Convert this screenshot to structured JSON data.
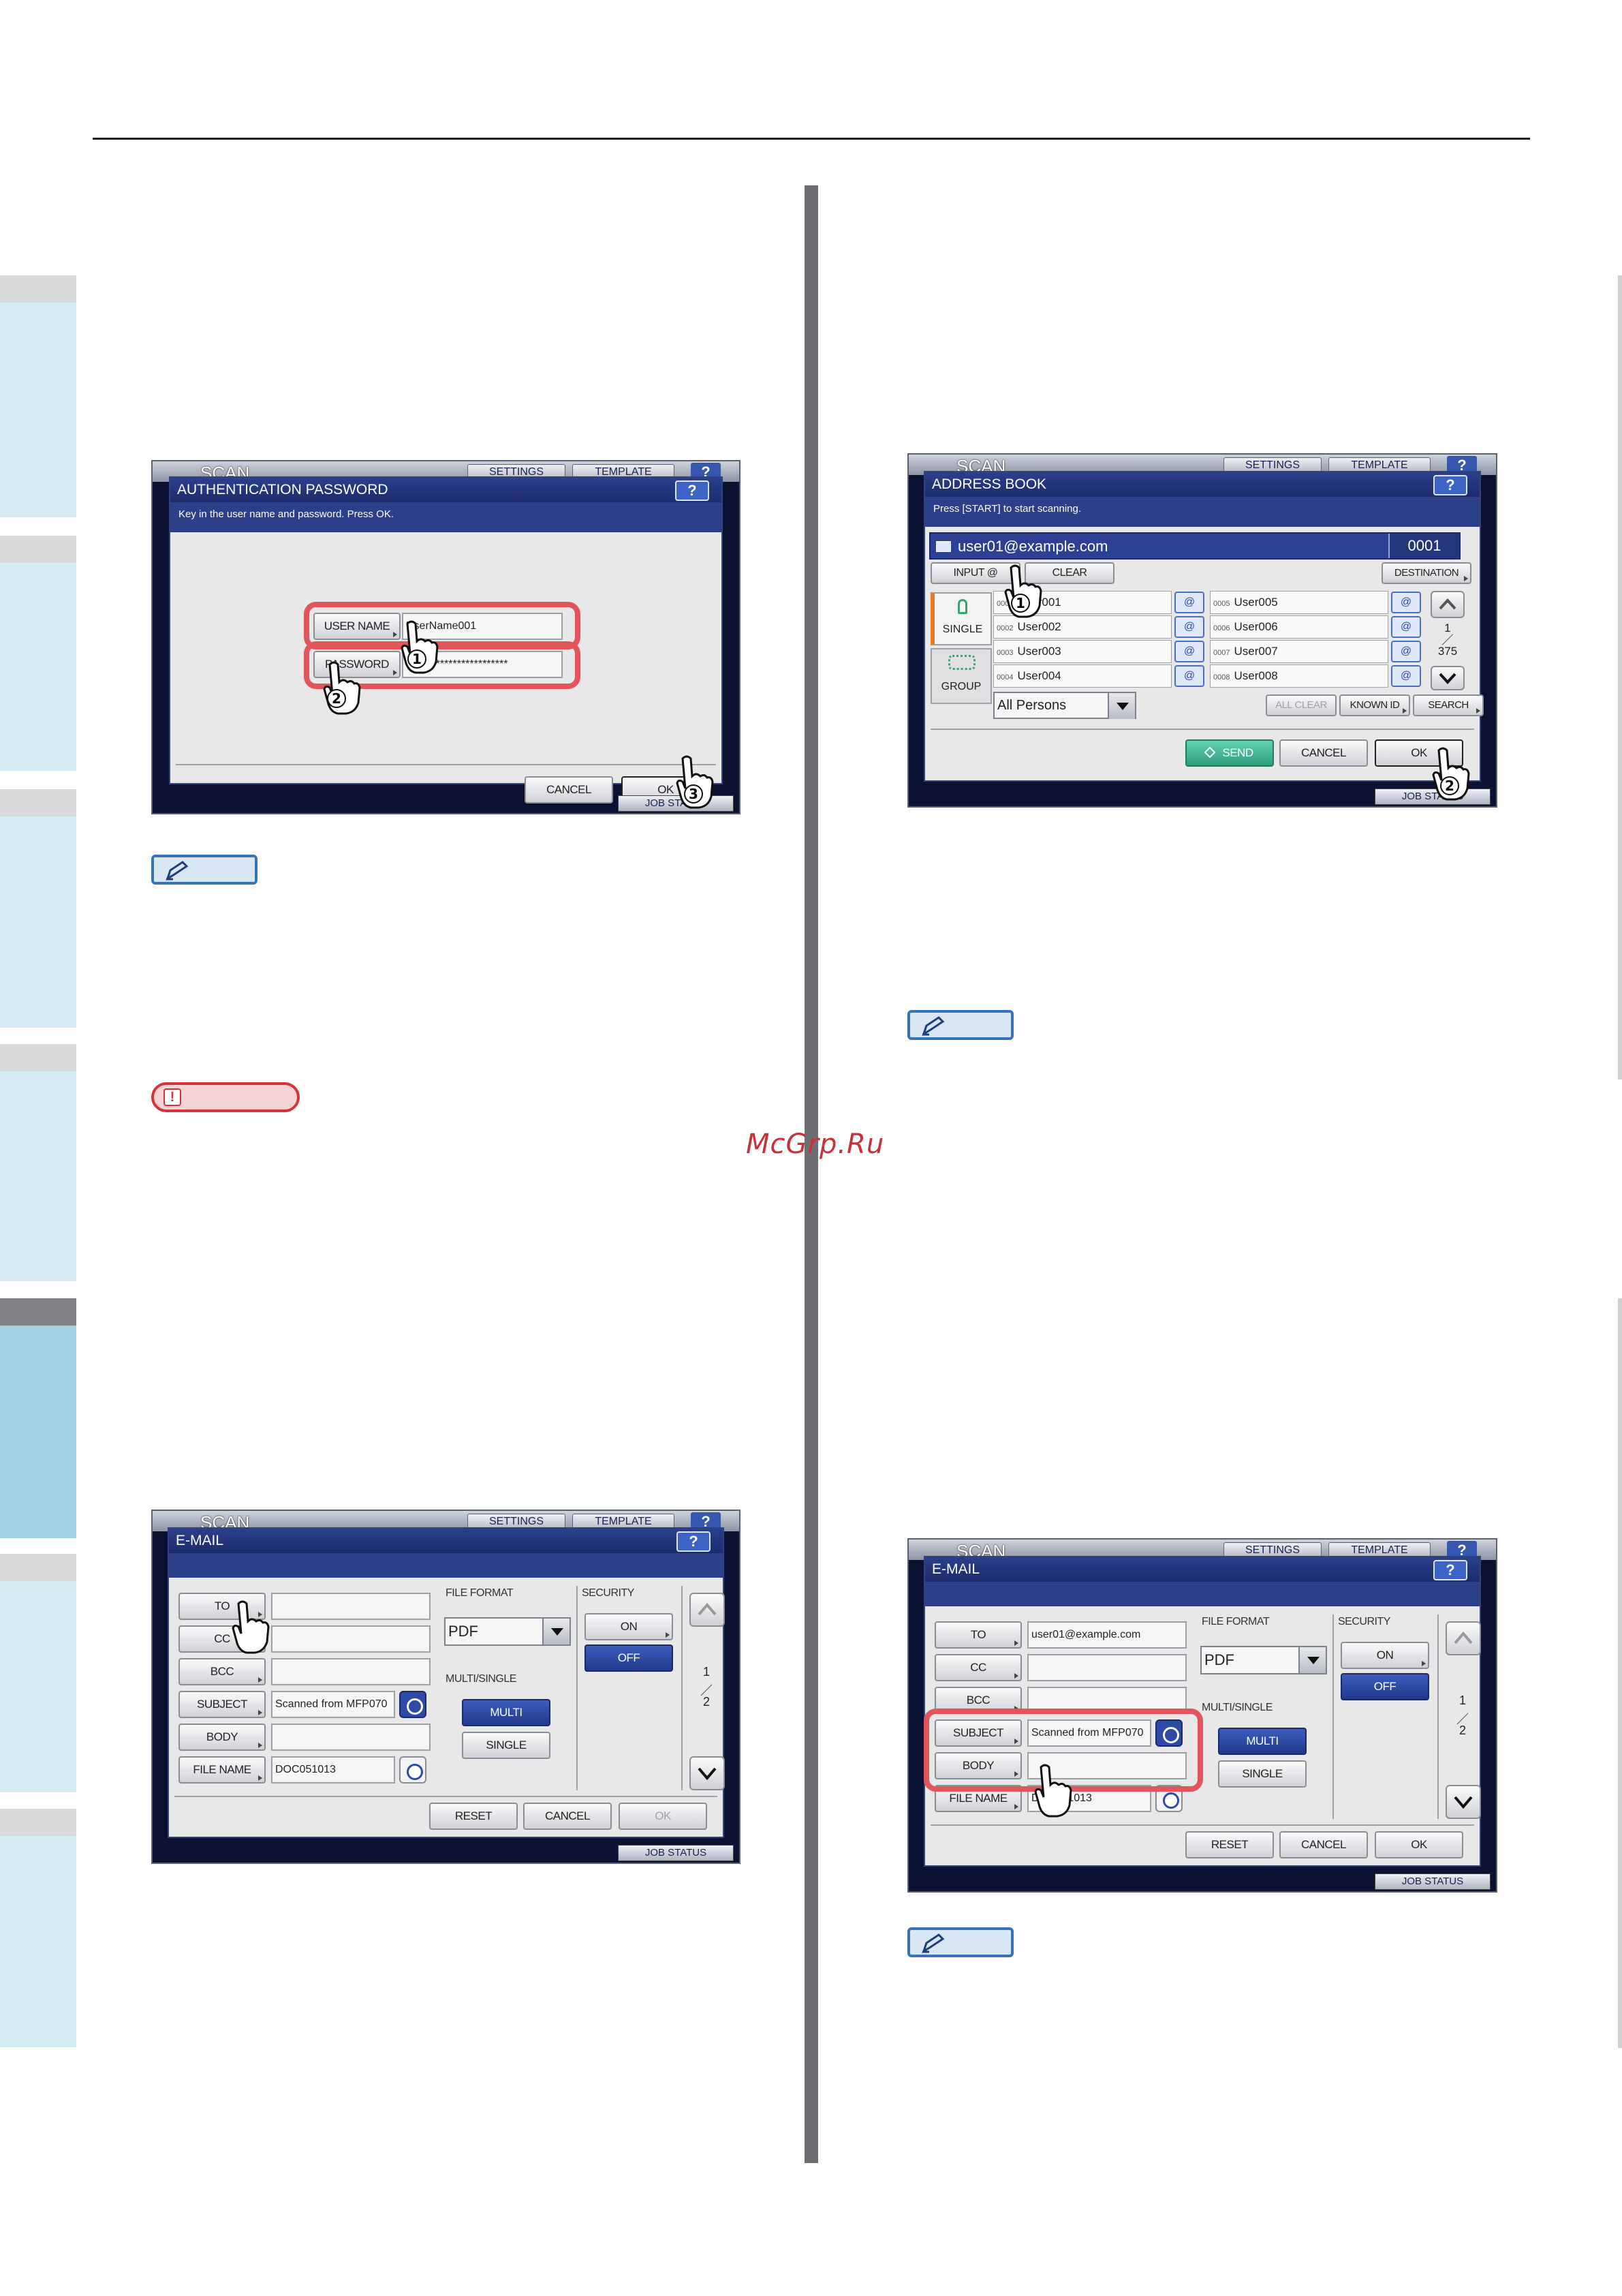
{
  "watermark": "McGrp.Ru",
  "auth_screen": {
    "scan_title": "SCAN",
    "settings": "SETTINGS",
    "template": "TEMPLATE",
    "help": "?",
    "dialog_title": "AUTHENTICATION PASSWORD",
    "instruction": "Key in the user name and password. Press OK.",
    "user_name_label": "USER NAME",
    "user_name_value": "UserName001",
    "password_label": "PASSWORD",
    "password_value": "************************",
    "cancel": "CANCEL",
    "ok": "OK",
    "job_status": "JOB STATUS",
    "callouts": [
      "1",
      "2",
      "3"
    ]
  },
  "address_book_screen": {
    "scan_title": "SCAN",
    "settings": "SETTINGS",
    "template": "TEMPLATE",
    "help": "?",
    "dialog_title": "ADDRESS BOOK",
    "instruction": "Press [START] to start scanning.",
    "address": "user01@example.com",
    "count": "0001",
    "input_at": "INPUT @",
    "clear": "CLEAR",
    "destination": "DESTINATION",
    "single": "SINGLE",
    "group": "GROUP",
    "entries_left": [
      {
        "num": "0001",
        "name": "User001"
      },
      {
        "num": "0002",
        "name": "User002"
      },
      {
        "num": "0003",
        "name": "User003"
      },
      {
        "num": "0004",
        "name": "User004"
      }
    ],
    "entries_right": [
      {
        "num": "0005",
        "name": "User005"
      },
      {
        "num": "0006",
        "name": "User006"
      },
      {
        "num": "0007",
        "name": "User007"
      },
      {
        "num": "0008",
        "name": "User008"
      }
    ],
    "at_sign": "@",
    "page_current": "1",
    "page_total": "375",
    "filter": "All Persons",
    "all_clear": "ALL CLEAR",
    "known_id": "KNOWN ID",
    "search": "SEARCH",
    "send": "SEND",
    "cancel": "CANCEL",
    "ok": "OK",
    "job_status": "JOB STATUS",
    "callouts": [
      "1",
      "2"
    ]
  },
  "email_screen_1": {
    "scan_title": "SCAN",
    "settings": "SETTINGS",
    "template": "TEMPLATE",
    "help": "?",
    "dialog_title": "E-MAIL",
    "to": "TO",
    "cc": "CC",
    "bcc": "BCC",
    "subject": "SUBJECT",
    "body": "BODY",
    "file_name": "FILE NAME",
    "to_value": "",
    "subject_value": "Scanned from MFP070",
    "file_name_value": "DOC051013",
    "file_format_label": "FILE FORMAT",
    "file_format_value": "PDF",
    "security_label": "SECURITY",
    "on": "ON",
    "off": "OFF",
    "multi_single_label": "MULTI/SINGLE",
    "multi": "MULTI",
    "single": "SINGLE",
    "page_current": "1",
    "page_total": "2",
    "reset": "RESET",
    "cancel": "CANCEL",
    "ok": "OK",
    "job_status": "JOB STATUS"
  },
  "email_screen_2": {
    "scan_title": "SCAN",
    "settings": "SETTINGS",
    "template": "TEMPLATE",
    "help": "?",
    "dialog_title": "E-MAIL",
    "to": "TO",
    "cc": "CC",
    "bcc": "BCC",
    "subject": "SUBJECT",
    "body": "BODY",
    "file_name": "FILE NAME",
    "to_value": "user01@example.com",
    "subject_value": "Scanned from MFP070",
    "file_name_value": "DOC051013",
    "file_format_label": "FILE FORMAT",
    "file_format_value": "PDF",
    "security_label": "SECURITY",
    "on": "ON",
    "off": "OFF",
    "multi_single_label": "MULTI/SINGLE",
    "multi": "MULTI",
    "single": "SINGLE",
    "page_current": "1",
    "page_total": "2",
    "reset": "RESET",
    "cancel": "CANCEL",
    "ok": "OK",
    "job_status": "JOB STATUS"
  }
}
